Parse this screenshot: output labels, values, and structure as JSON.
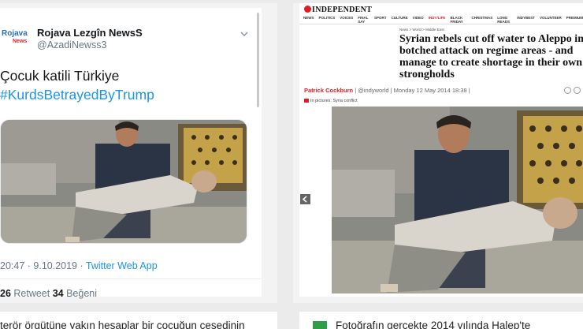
{
  "tweet": {
    "logo_main": "Rojava",
    "logo_sub": "News",
    "display_name": "Rojava Lezgîn NewsS",
    "handle": "@AzadiNewss3",
    "text_line1": "Çocuk katili Türkiye",
    "hashtag": "#KurdsBetrayedByTrump",
    "time_date": "20:47 · 9.10.2019 · ",
    "source_app": "Twitter Web App",
    "retweet_count": "26",
    "retweet_label": " Retweet  ",
    "like_count": "34",
    "like_label": " Beğeni"
  },
  "article": {
    "logo": "INDEPENDENT",
    "nav": [
      "NEWS",
      "POLITICS",
      "VOICES",
      "FINAL SAY",
      "SPORT",
      "CULTURE",
      "VIDEO",
      "INDY/LIFE",
      "BLACK FRIDAY",
      "CHRISTMAS",
      "LONG READS",
      "INDYBEST",
      "VOLUNTEER",
      "PREMIUM"
    ],
    "nav_active_index": 7,
    "breadcrumbs": "News > World > Middle East",
    "headline": "Syrian rebels cut off water to Aleppo in botched attack on regime areas - and manage to create shortage in their own strongholds",
    "author": "Patrick Cockburn",
    "byline_rest": " | @indyworld | Monday 12 May 2014 18:38 |",
    "in_pictures": "In pictures: Syria conflict"
  },
  "bottom": {
    "left_text": "terör örgütüne yakın hesaplar bir çocuğun cesedinin",
    "right_text": "Fotoğrafın gerçekte 2014 yılında Halep'te"
  }
}
